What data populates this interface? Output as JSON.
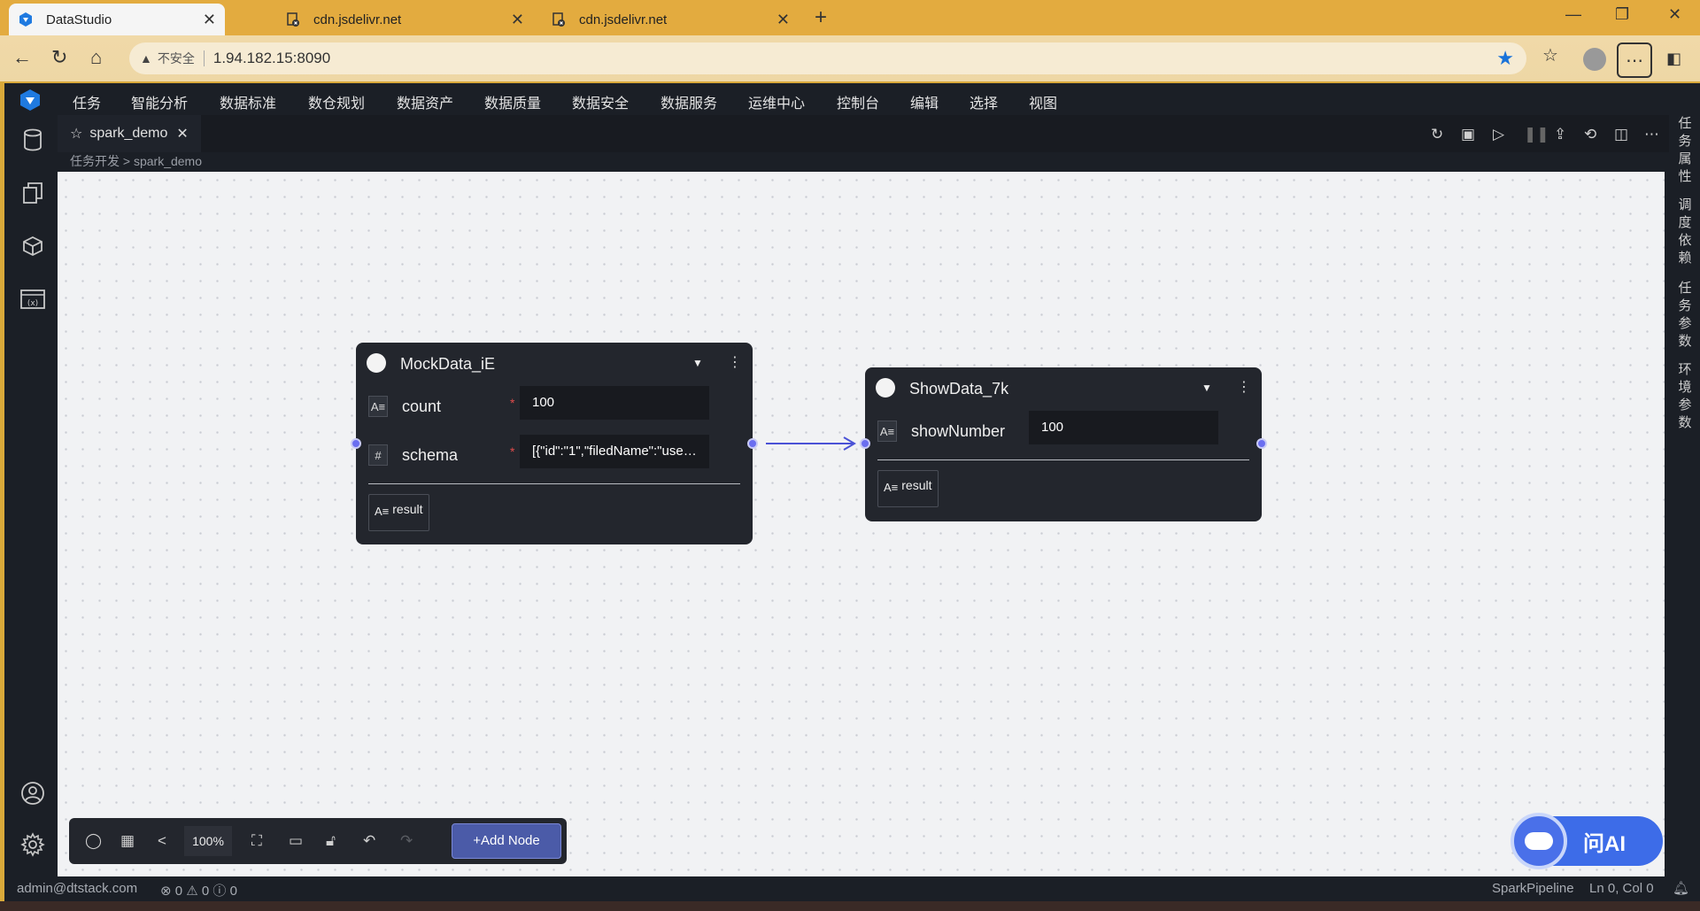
{
  "browser": {
    "tabs": [
      {
        "title": "DataStudio",
        "active": true
      },
      {
        "title": "cdn.jsdelivr.net",
        "active": false
      },
      {
        "title": "cdn.jsdelivr.net",
        "active": false
      }
    ],
    "address": {
      "security_label": "不安全",
      "url": "1.94.182.15:8090"
    }
  },
  "app": {
    "menu": [
      "任务",
      "智能分析",
      "数据标准",
      "数仓规划",
      "数据资产",
      "数据质量",
      "数据安全",
      "数据服务",
      "运维中心",
      "控制台",
      "编辑",
      "选择",
      "视图"
    ],
    "sidebar_icons": [
      "database-icon",
      "files-icon",
      "cube-icon",
      "variable-icon",
      "user-icon",
      "settings-icon"
    ],
    "editor_tab": {
      "title": "spark_demo"
    },
    "breadcrumb": {
      "root": "任务开发",
      "separator": ">",
      "current": "spark_demo"
    },
    "right_panel": [
      "任务属性",
      "调度依赖",
      "任务参数",
      "环境参数"
    ],
    "nodes": [
      {
        "title": "MockData_iE",
        "fields": [
          {
            "label": "count",
            "required": true,
            "value": "100",
            "icon": "A≡"
          },
          {
            "label": "schema",
            "required": true,
            "value": "[{\"id\":\"1\",\"filedName\":\"user...",
            "icon": "#"
          }
        ],
        "output": "result"
      },
      {
        "title": "ShowData_7k",
        "fields": [
          {
            "label": "showNumber",
            "required": false,
            "value": "100",
            "icon": "A≡"
          }
        ],
        "output": "result"
      }
    ],
    "toolbar": {
      "zoom": "100%",
      "add_node": "+Add Node"
    },
    "ai_button": "问AI",
    "status": {
      "user": "admin@dtstack.com",
      "errors": "0",
      "warnings": "0",
      "infos": "0",
      "language": "SparkPipeline",
      "cursor": "Ln 0, Col 0"
    }
  }
}
